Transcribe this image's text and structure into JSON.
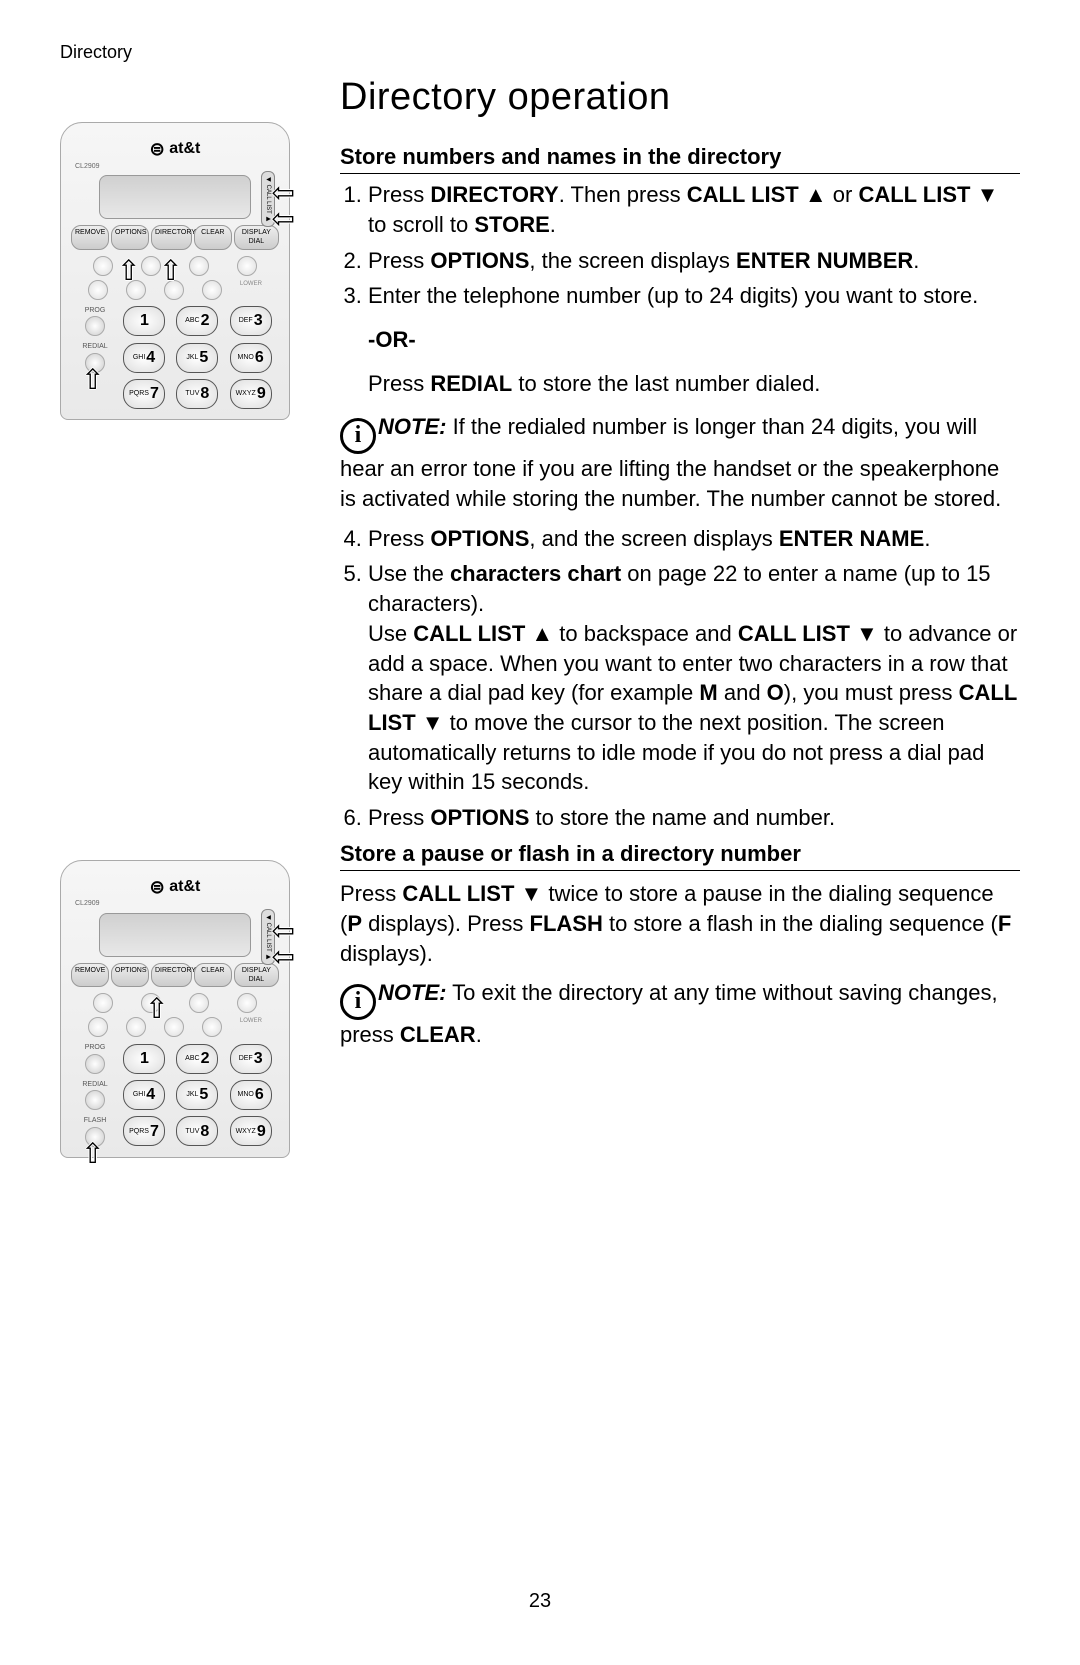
{
  "header_label": "Directory",
  "title": "Directory operation",
  "section1_heading": "Store numbers and names in the directory",
  "steps123": {
    "s1a": "Press ",
    "s1b": "DIRECTORY",
    "s1c": ". Then press ",
    "s1d": "CALL LIST ▲",
    "s1e": " or ",
    "s1f": "CALL LIST ▼",
    "s1g": " to scroll to ",
    "s1h": "STORE",
    "s1i": ".",
    "s2a": "Press ",
    "s2b": "OPTIONS",
    "s2c": ", the screen displays ",
    "s2d": "ENTER NUMBER",
    "s2e": ".",
    "s3": "Enter the telephone number (up to 24 digits) you want to store."
  },
  "or_label": "-OR-",
  "redial": {
    "a": "Press ",
    "b": "REDIAL",
    "c": " to store the last number dialed."
  },
  "note1": {
    "label": "NOTE:",
    "text": " If the redialed number is longer than 24 digits, you will hear an error tone if you are lifting the handset or the speakerphone is activated while storing the number. The number cannot be stored."
  },
  "steps456": {
    "s4a": "Press ",
    "s4b": "OPTIONS",
    "s4c": ", and the screen displays ",
    "s4d": "ENTER NAME",
    "s4e": ".",
    "s5a": "Use the ",
    "s5b": "characters chart",
    "s5c": " on page 22 to enter a name (up to 15 characters).",
    "s5d": "Use ",
    "s5e": "CALL LIST ▲",
    "s5f": " to backspace and ",
    "s5g": "CALL LIST ▼",
    "s5h": " to advance or add a space. When you want to enter two characters in a row that share a dial pad key (for example ",
    "s5i": "M",
    "s5j": " and ",
    "s5k": "O",
    "s5l": "), you must press ",
    "s5m": "CALL LIST ▼",
    "s5n": " to move the cursor to the next position. The screen automatically returns to idle mode if you do not press a dial pad key within 15 seconds.",
    "s6a": "Press ",
    "s6b": "OPTIONS",
    "s6c": " to store the name and number."
  },
  "section2_heading": "Store a pause or flash in a directory number",
  "section2": {
    "a": "Press ",
    "b": "CALL LIST ▼",
    "c": " twice to store a pause in the dialing sequence (",
    "d": "P",
    "e": " displays). Press ",
    "f": "FLASH",
    "g": " to store a flash in the dialing sequence (",
    "h": "F",
    "i": " displays)."
  },
  "note2": {
    "label": "NOTE:",
    "text": " To exit the directory at any time without saving changes, press ",
    "b": "CLEAR",
    "c": "."
  },
  "page_number": "23",
  "phone": {
    "brand": "at&t",
    "model": "CL2909",
    "fn": [
      "REMOVE",
      "OPTIONS",
      "DIRECTORY",
      "CLEAR",
      "DISPLAY DIAL"
    ],
    "scroll": "◀ CALL LIST ▶",
    "lower": "LOWER",
    "side_labels_a": [
      "PROG",
      "REDIAL",
      ""
    ],
    "side_labels_b": [
      "PROG",
      "REDIAL",
      "FLASH"
    ],
    "keys": [
      {
        "sub": "",
        "num": "1"
      },
      {
        "sub": "ABC",
        "num": "2"
      },
      {
        "sub": "DEF",
        "num": "3"
      },
      {
        "sub": "GHI",
        "num": "4"
      },
      {
        "sub": "JKL",
        "num": "5"
      },
      {
        "sub": "MNO",
        "num": "6"
      },
      {
        "sub": "PQRS",
        "num": "7"
      },
      {
        "sub": "TUV",
        "num": "8"
      },
      {
        "sub": "WXYZ",
        "num": "9"
      }
    ]
  }
}
